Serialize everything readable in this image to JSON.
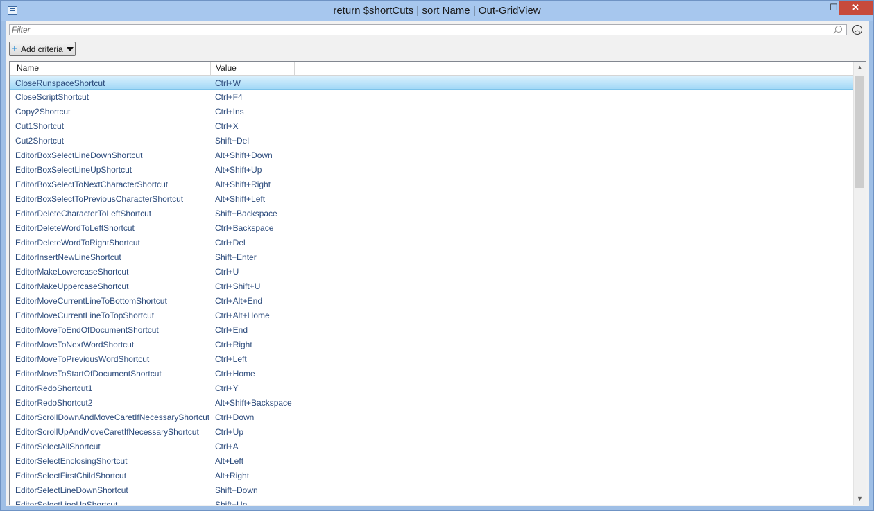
{
  "window": {
    "title": "return $shortCuts | sort Name | Out-GridView",
    "min_glyph": "—",
    "max_glyph": "☐",
    "close_glyph": "✕"
  },
  "filter": {
    "placeholder": "Filter",
    "collapse_glyph": "︿"
  },
  "criteria": {
    "label": "Add criteria"
  },
  "grid": {
    "columns": [
      "Name",
      "Value"
    ],
    "selected_index": 0,
    "rows": [
      {
        "name": "CloseRunspaceShortcut",
        "value": "Ctrl+W"
      },
      {
        "name": "CloseScriptShortcut",
        "value": "Ctrl+F4"
      },
      {
        "name": "Copy2Shortcut",
        "value": "Ctrl+Ins"
      },
      {
        "name": "Cut1Shortcut",
        "value": "Ctrl+X"
      },
      {
        "name": "Cut2Shortcut",
        "value": "Shift+Del"
      },
      {
        "name": "EditorBoxSelectLineDownShortcut",
        "value": "Alt+Shift+Down"
      },
      {
        "name": "EditorBoxSelectLineUpShortcut",
        "value": "Alt+Shift+Up"
      },
      {
        "name": "EditorBoxSelectToNextCharacterShortcut",
        "value": "Alt+Shift+Right"
      },
      {
        "name": "EditorBoxSelectToPreviousCharacterShortcut",
        "value": "Alt+Shift+Left"
      },
      {
        "name": "EditorDeleteCharacterToLeftShortcut",
        "value": "Shift+Backspace"
      },
      {
        "name": "EditorDeleteWordToLeftShortcut",
        "value": "Ctrl+Backspace"
      },
      {
        "name": "EditorDeleteWordToRightShortcut",
        "value": "Ctrl+Del"
      },
      {
        "name": "EditorInsertNewLineShortcut",
        "value": "Shift+Enter"
      },
      {
        "name": "EditorMakeLowercaseShortcut",
        "value": "Ctrl+U"
      },
      {
        "name": "EditorMakeUppercaseShortcut",
        "value": "Ctrl+Shift+U"
      },
      {
        "name": "EditorMoveCurrentLineToBottomShortcut",
        "value": "Ctrl+Alt+End"
      },
      {
        "name": "EditorMoveCurrentLineToTopShortcut",
        "value": "Ctrl+Alt+Home"
      },
      {
        "name": "EditorMoveToEndOfDocumentShortcut",
        "value": "Ctrl+End"
      },
      {
        "name": "EditorMoveToNextWordShortcut",
        "value": "Ctrl+Right"
      },
      {
        "name": "EditorMoveToPreviousWordShortcut",
        "value": "Ctrl+Left"
      },
      {
        "name": "EditorMoveToStartOfDocumentShortcut",
        "value": "Ctrl+Home"
      },
      {
        "name": "EditorRedoShortcut1",
        "value": "Ctrl+Y"
      },
      {
        "name": "EditorRedoShortcut2",
        "value": "Alt+Shift+Backspace"
      },
      {
        "name": "EditorScrollDownAndMoveCaretIfNecessaryShortcut",
        "value": "Ctrl+Down"
      },
      {
        "name": "EditorScrollUpAndMoveCaretIfNecessaryShortcut",
        "value": "Ctrl+Up"
      },
      {
        "name": "EditorSelectAllShortcut",
        "value": "Ctrl+A"
      },
      {
        "name": "EditorSelectEnclosingShortcut",
        "value": "Alt+Left"
      },
      {
        "name": "EditorSelectFirstChildShortcut",
        "value": "Alt+Right"
      },
      {
        "name": "EditorSelectLineDownShortcut",
        "value": "Shift+Down"
      },
      {
        "name": "EditorSelectLineUpShortcut",
        "value": "Shift+Up"
      }
    ]
  },
  "scrollbar": {
    "up_glyph": "▲",
    "down_glyph": "▼"
  }
}
